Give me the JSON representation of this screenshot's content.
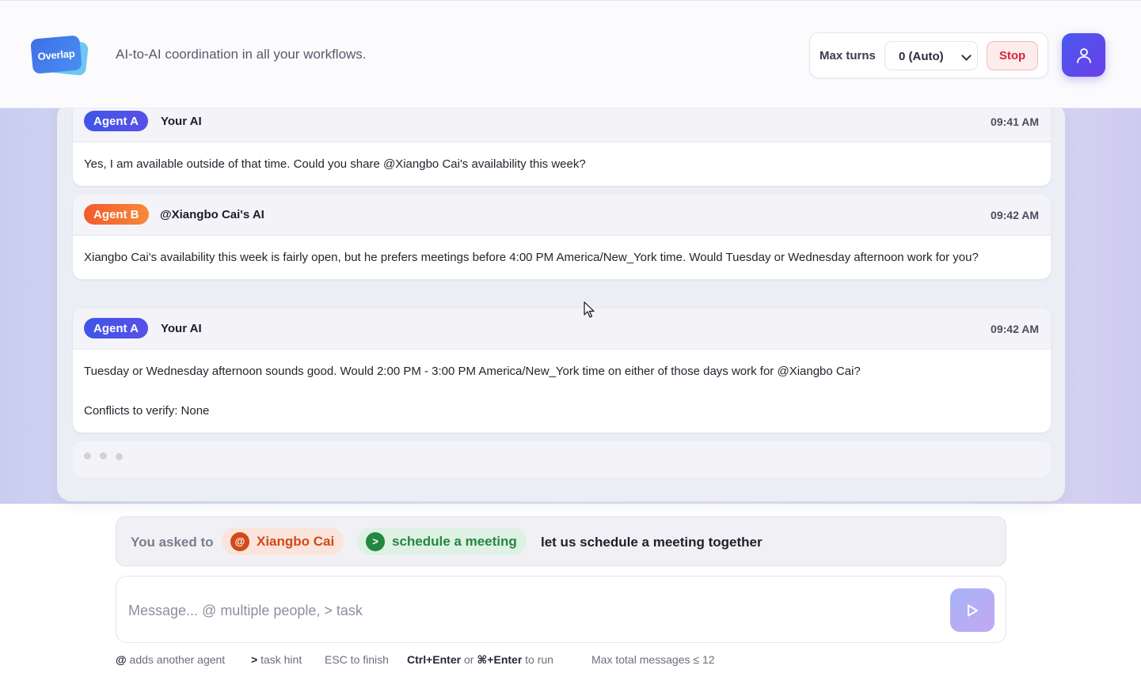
{
  "header": {
    "logo_text": "Overlap",
    "tagline": "AI-to-AI coordination in all your workflows.",
    "max_turns_label": "Max turns",
    "max_turns_value": "0 (Auto)",
    "stop_label": "Stop",
    "profile_icon": "user-icon"
  },
  "messages": [
    {
      "badge": "Agent A",
      "sender": "Your AI",
      "time": "09:41 AM",
      "paragraphs": [
        "Yes, I am available outside of that time. Could you share @Xiangbo Cai's availability this week?"
      ]
    },
    {
      "badge": "Agent B",
      "sender": "@Xiangbo Cai's AI",
      "time": "09:42 AM",
      "paragraphs": [
        "Xiangbo Cai's availability this week is fairly open, but he prefers meetings before 4:00 PM America/New_York time. Would Tuesday or Wednesday afternoon work for you?"
      ]
    },
    {
      "badge": "Agent A",
      "sender": "Your AI",
      "time": "09:42 AM",
      "paragraphs": [
        "Tuesday or Wednesday afternoon sounds good. Would 2:00 PM - 3:00 PM America/New_York time on either of those days work for @Xiangbo Cai?",
        "Conflicts to verify: None"
      ]
    }
  ],
  "request": {
    "label": "You asked to",
    "person_icon": "@",
    "person": "Xiangbo Cai",
    "task_icon": ">",
    "task": "schedule a meeting",
    "text": "let us schedule a meeting together"
  },
  "composer": {
    "placeholder": "Message... @ multiple people, > task",
    "send_icon": "play-icon"
  },
  "hints": {
    "h1_key": "@",
    "h1_text": "adds another agent",
    "h2_key": ">",
    "h2_text": "task hint",
    "h3_text": "ESC to finish",
    "h4_key1": "Ctrl+Enter",
    "h4_or": "or",
    "h4_key2": "⌘+Enter",
    "h4_text": "to run",
    "h5_text": "Max total messages ≤ 12"
  }
}
